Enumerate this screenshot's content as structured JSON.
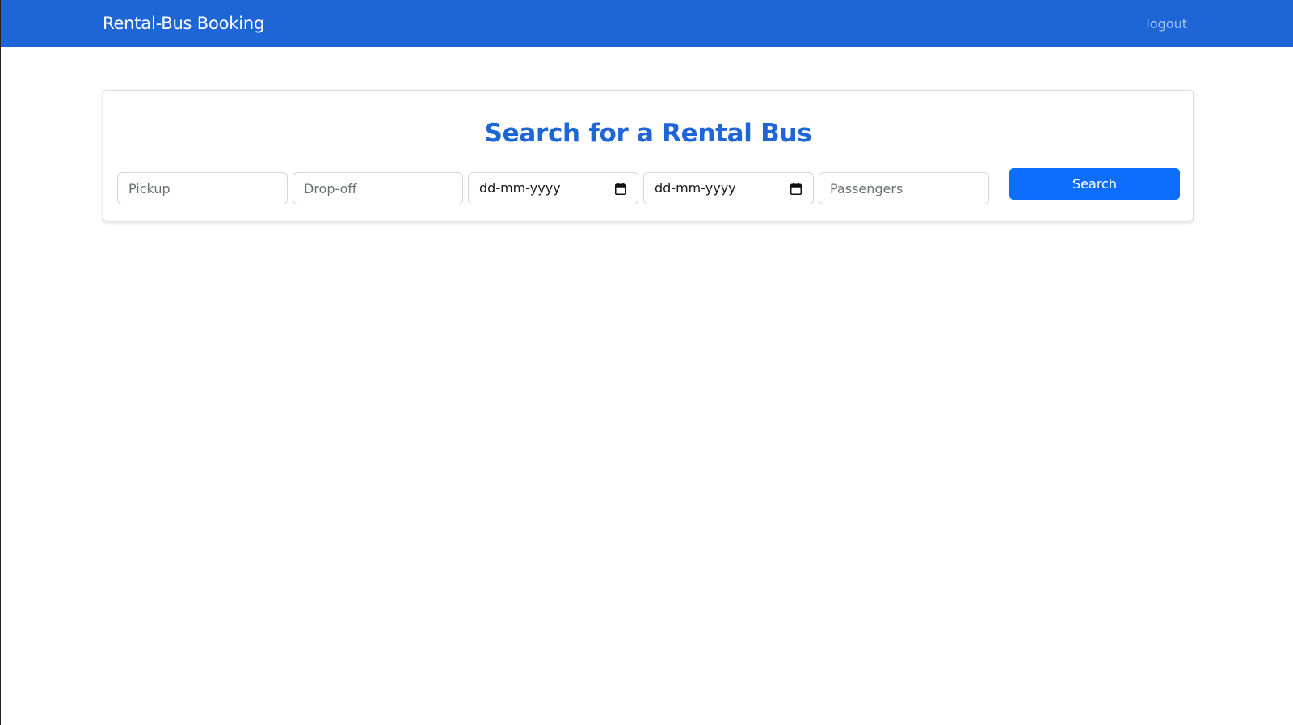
{
  "navbar": {
    "brand": "Rental-Bus Booking",
    "logout": "logout",
    "background_color": "#1e65d6"
  },
  "search_card": {
    "title": "Search for a Rental Bus",
    "title_color": "#1e65d6",
    "fields": {
      "pickup": {
        "placeholder": "Pickup",
        "value": ""
      },
      "dropoff": {
        "placeholder": "Drop-off",
        "value": ""
      },
      "start_date": {
        "display": "dd-mm-yyyy",
        "icon": "calendar-icon"
      },
      "end_date": {
        "display": "dd-mm-yyyy",
        "icon": "calendar-icon"
      },
      "passengers": {
        "placeholder": "Passengers",
        "value": ""
      }
    },
    "search_button": {
      "label": "Search",
      "color": "#0d6efd"
    }
  }
}
